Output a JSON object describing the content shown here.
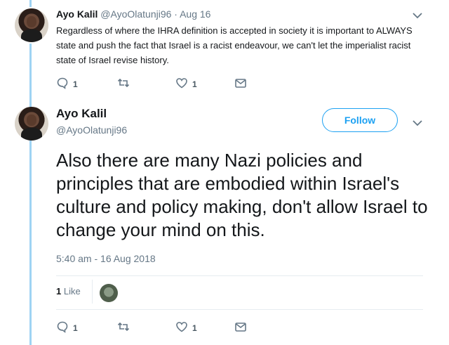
{
  "tweet1": {
    "name": "Ayo Kalil",
    "handle": "@AyoOlatunji96",
    "separator": "·",
    "date": "Aug 16",
    "text": "Regardless of where the IHRA definition is accepted in society it is important to ALWAYS state and push the fact that Israel is a racist endeavour, we can't let the imperialist racist state of Israel revise history.",
    "reply_count": "1",
    "like_count": "1"
  },
  "tweet2": {
    "name": "Ayo Kalil",
    "handle": "@AyoOlatunji96",
    "follow_label": "Follow",
    "text": "Also there are many Nazi policies and principles that are embodied within Israel's culture and policy making, don't allow Israel to change your mind on this.",
    "timestamp": "5:40 am - 16 Aug 2018",
    "likes_count": "1",
    "likes_label": "Like",
    "reply_count": "1",
    "like_count": "1"
  },
  "icons": [
    "reply-icon",
    "retweet-icon",
    "heart-icon",
    "message-icon",
    "chevron-down-icon"
  ],
  "colors": {
    "thread_line": "#9fd3f3",
    "accent": "#1da1f2",
    "muted": "#657786"
  }
}
